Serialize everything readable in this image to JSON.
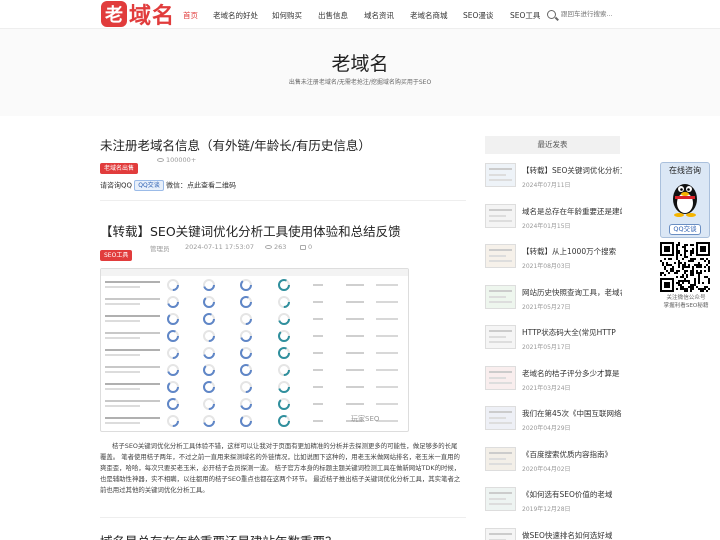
{
  "site": {
    "logo_badge": "老",
    "logo_text": "域名",
    "brand_color": "#e13c3c"
  },
  "nav": {
    "items": [
      {
        "label": "首页",
        "active": true
      },
      {
        "label": "老域名的好处"
      },
      {
        "label": "如何购买"
      },
      {
        "label": "出售信息"
      },
      {
        "label": "域名资讯"
      },
      {
        "label": "老域名商城"
      },
      {
        "label": "SEO漫谈"
      },
      {
        "label": "SEO工具"
      }
    ],
    "search_placeholder": "跟回车进行搜索..."
  },
  "hero": {
    "title": "老域名",
    "subtitle": "出售未注册老域名/无需老抢注/挖掘域名购买用于SEO"
  },
  "post1": {
    "title": "未注册老域名信息（有外链/年龄长/有历史信息）",
    "tag": "老域名出售",
    "views": "100000+",
    "contact_prefix": "请咨询QQ",
    "qq_button": "QQ交谈",
    "wechat": "微信：点此查看二维码"
  },
  "post2": {
    "title": "【转载】SEO关键词优化分析工具使用体验和总结反馈",
    "tag": "SEO工具",
    "author": "管理员",
    "datetime": "2024-07-11 17:53:07",
    "views": "263",
    "comments": "0",
    "watermark": "玩家SEO",
    "excerpt": "桔子SEO关键词优化分析工具体验不错，这样可以让我对于页面有更加精准的分析并去探测更多的可能性，做足够多的长尾覆盖。  笔者使用桔子两年，不过之前一直用来探测域名的外链情况，比如说图下这种的，用老玉米做网站排名，老玉米一直用的爽歪歪，哈哈，每次只要买老玉米，必开桔子会员探测一波。  桔子官方本身的标题主题关键词检测工具在做新网站TDK的时候，也是辅助性神器，实不相瞒，以往都用的桔子SEO重点也都在这两个环节。  最近桔子推出桔子关键词优化分析工具，其实笔者之前也用过其他的关键词优化分析工具。"
  },
  "post3": {
    "title": "域名是总存在年龄重要还是建站年数重要？"
  },
  "sidebar": {
    "heading": "最近发表",
    "items": [
      {
        "title": "【转载】SEO关键词优化分析工具使用体验和总结反馈",
        "date": "2024年07月11日"
      },
      {
        "title": "域名是总存在年龄重要还是建站年数重要",
        "date": "2024年01月15日"
      },
      {
        "title": "【转载】从上1000万个搜索",
        "date": "2021年08月03日"
      },
      {
        "title": "网站历史快照查询工具，老域名",
        "date": "2021年05月27日"
      },
      {
        "title": "HTTP状态码大全(常见HTTP",
        "date": "2021年05月17日"
      },
      {
        "title": "老域名的桔子评分多少才算是",
        "date": "2021年03月24日"
      },
      {
        "title": "我们在第45次《中国互联网络",
        "date": "2020年04月29日"
      },
      {
        "title": "《百度搜索优质内容指南》",
        "date": "2020年04月02日"
      },
      {
        "title": "《如何选有SEO价值的老域",
        "date": "2019年12月28日"
      },
      {
        "title": "做SEO快速排名如何选好域",
        "date": ""
      }
    ]
  },
  "float": {
    "title": "在线咨询",
    "button": "QQ交谈",
    "caption_line1": "关注微信公众号",
    "caption_line2": "掌握利看SEO秘籍"
  }
}
